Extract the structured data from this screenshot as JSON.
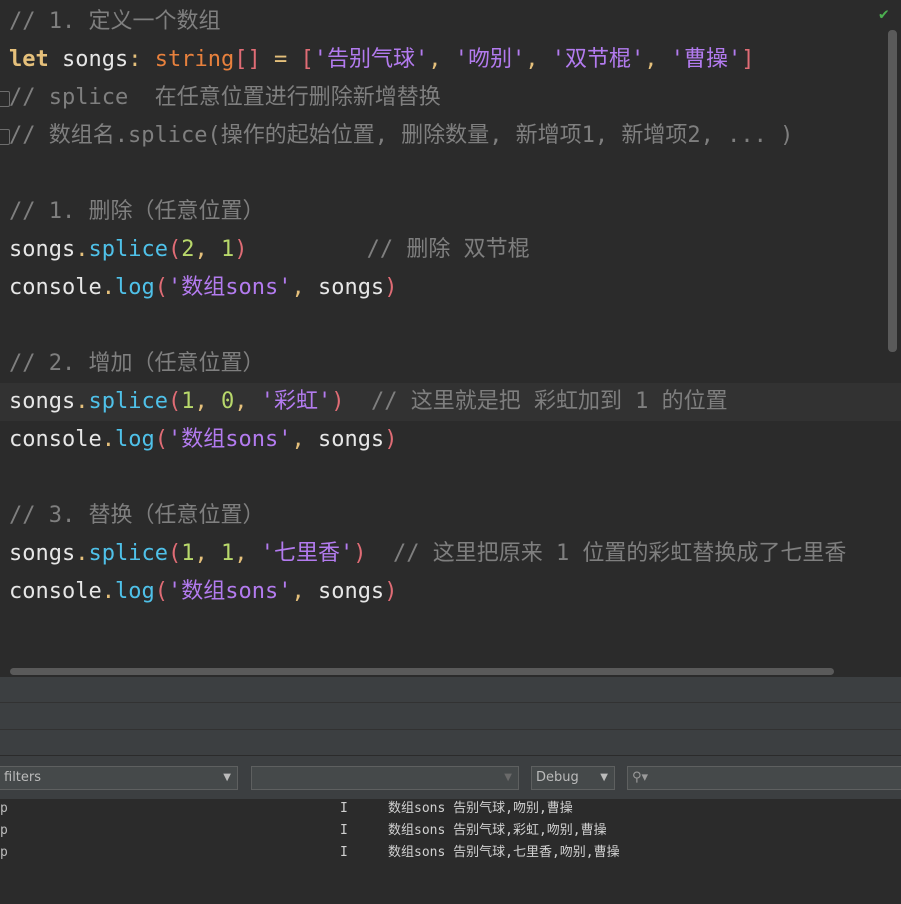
{
  "editor": {
    "lines": [
      {
        "tokens": [
          {
            "t": "// 1. 定义一个数组",
            "c": "comment"
          }
        ]
      },
      {
        "tokens": [
          {
            "t": "let",
            "c": "kw"
          },
          {
            "t": " songs",
            "c": "plain"
          },
          {
            "t": ":",
            "c": "punct"
          },
          {
            "t": " ",
            "c": "plain"
          },
          {
            "t": "string",
            "c": "type"
          },
          {
            "t": "[]",
            "c": "br"
          },
          {
            "t": " = ",
            "c": "punct"
          },
          {
            "t": "[",
            "c": "br"
          },
          {
            "t": "'告别气球'",
            "c": "str"
          },
          {
            "t": ", ",
            "c": "punct"
          },
          {
            "t": "'吻别'",
            "c": "str"
          },
          {
            "t": ", ",
            "c": "punct"
          },
          {
            "t": "'双节棍'",
            "c": "str"
          },
          {
            "t": ", ",
            "c": "punct"
          },
          {
            "t": "'曹操'",
            "c": "str"
          },
          {
            "t": "]",
            "c": "br"
          }
        ]
      },
      {
        "tokens": [
          {
            "t": "// splice  在任意位置进行删除新增替换",
            "c": "comment"
          }
        ]
      },
      {
        "tokens": [
          {
            "t": "// 数组名.splice(操作的起始位置, 删除数量, 新增项1, 新增项2, ... )",
            "c": "comment"
          }
        ]
      },
      {
        "tokens": []
      },
      {
        "tokens": [
          {
            "t": "// 1. 删除（任意位置）",
            "c": "comment"
          }
        ]
      },
      {
        "tokens": [
          {
            "t": "songs",
            "c": "plain"
          },
          {
            "t": ".",
            "c": "punct"
          },
          {
            "t": "splice",
            "c": "fn"
          },
          {
            "t": "(",
            "c": "br"
          },
          {
            "t": "2",
            "c": "num"
          },
          {
            "t": ", ",
            "c": "punct"
          },
          {
            "t": "1",
            "c": "num"
          },
          {
            "t": ")",
            "c": "br"
          },
          {
            "t": "         // 删除 双节棍",
            "c": "comment"
          }
        ]
      },
      {
        "tokens": [
          {
            "t": "console",
            "c": "plain"
          },
          {
            "t": ".",
            "c": "punct"
          },
          {
            "t": "log",
            "c": "fn"
          },
          {
            "t": "(",
            "c": "br"
          },
          {
            "t": "'数组sons'",
            "c": "str"
          },
          {
            "t": ", ",
            "c": "punct"
          },
          {
            "t": "songs",
            "c": "plain"
          },
          {
            "t": ")",
            "c": "br"
          }
        ]
      },
      {
        "tokens": []
      },
      {
        "tokens": [
          {
            "t": "// 2. 增加（任意位置）",
            "c": "comment"
          }
        ]
      },
      {
        "tokens": [
          {
            "t": "songs",
            "c": "plain"
          },
          {
            "t": ".",
            "c": "punct"
          },
          {
            "t": "splice",
            "c": "fn"
          },
          {
            "t": "(",
            "c": "br"
          },
          {
            "t": "1",
            "c": "num"
          },
          {
            "t": ", ",
            "c": "punct"
          },
          {
            "t": "0",
            "c": "num"
          },
          {
            "t": ", ",
            "c": "punct"
          },
          {
            "t": "'彩虹'",
            "c": "str"
          },
          {
            "t": ")",
            "c": "br"
          },
          {
            "t": "  // 这里就是把 彩虹加到 1 的位置",
            "c": "comment"
          }
        ]
      },
      {
        "tokens": [
          {
            "t": "console",
            "c": "plain"
          },
          {
            "t": ".",
            "c": "punct"
          },
          {
            "t": "log",
            "c": "fn"
          },
          {
            "t": "(",
            "c": "br"
          },
          {
            "t": "'数组sons'",
            "c": "str"
          },
          {
            "t": ", ",
            "c": "punct"
          },
          {
            "t": "songs",
            "c": "plain"
          },
          {
            "t": ")",
            "c": "br"
          }
        ]
      },
      {
        "tokens": []
      },
      {
        "tokens": [
          {
            "t": "// 3. 替换（任意位置）",
            "c": "comment"
          }
        ]
      },
      {
        "tokens": [
          {
            "t": "songs",
            "c": "plain"
          },
          {
            "t": ".",
            "c": "punct"
          },
          {
            "t": "splice",
            "c": "fn"
          },
          {
            "t": "(",
            "c": "br"
          },
          {
            "t": "1",
            "c": "num"
          },
          {
            "t": ", ",
            "c": "punct"
          },
          {
            "t": "1",
            "c": "num"
          },
          {
            "t": ", ",
            "c": "punct"
          },
          {
            "t": "'七里香'",
            "c": "str"
          },
          {
            "t": ")",
            "c": "br"
          },
          {
            "t": "  // 这里把原来 1 位置的彩虹替换成了七里香",
            "c": "comment"
          }
        ]
      },
      {
        "tokens": [
          {
            "t": "console",
            "c": "plain"
          },
          {
            "t": ".",
            "c": "punct"
          },
          {
            "t": "log",
            "c": "fn"
          },
          {
            "t": "(",
            "c": "br"
          },
          {
            "t": "'数组sons'",
            "c": "str"
          },
          {
            "t": ", ",
            "c": "punct"
          },
          {
            "t": "songs",
            "c": "plain"
          },
          {
            "t": ")",
            "c": "br"
          }
        ]
      }
    ],
    "current_line": 10,
    "check_icon": "check-icon"
  },
  "filterbar": {
    "filter_select": "filters",
    "process_select": "",
    "level_select": "Debug",
    "search_placeholder": ""
  },
  "log": [
    {
      "pkg": "p",
      "level": "I",
      "message": "数组sons 告别气球,吻别,曹操"
    },
    {
      "pkg": "p",
      "level": "I",
      "message": "数组sons 告别气球,彩虹,吻别,曹操"
    },
    {
      "pkg": "p",
      "level": "I",
      "message": "数组sons 告别气球,七里香,吻别,曹操"
    }
  ],
  "colors": {
    "comment": "#7f7f7f",
    "keyword": "#e5c07b",
    "type": "#e8813d",
    "string": "#b37bef",
    "function": "#4fc1e9",
    "number": "#b8d86b",
    "bracket": "#e06c75",
    "background": "#2b2b2b"
  }
}
